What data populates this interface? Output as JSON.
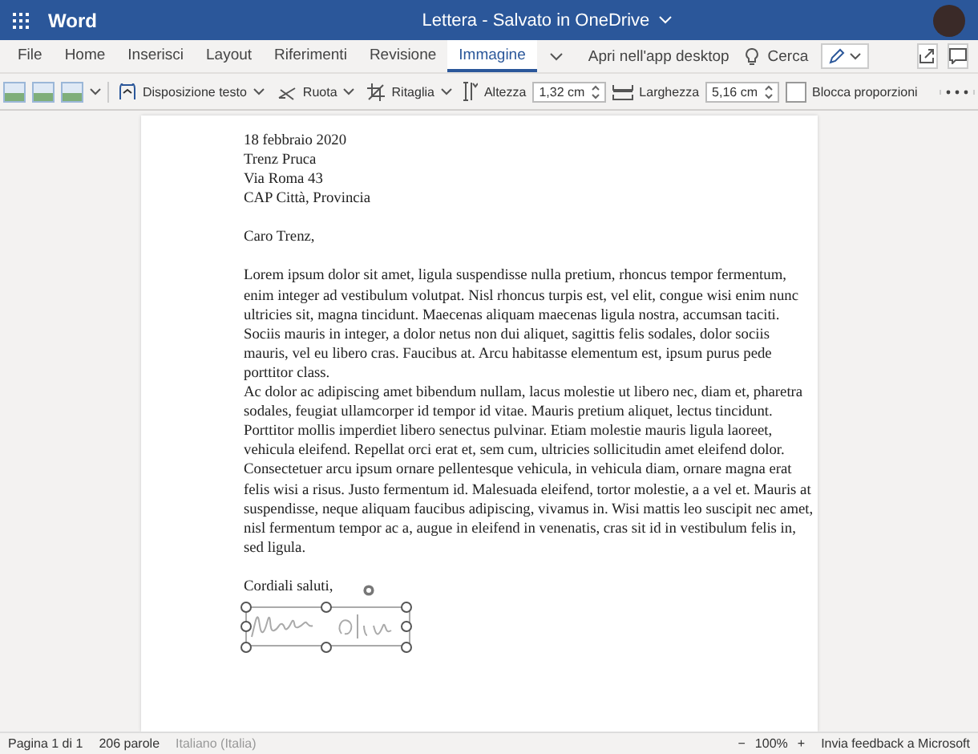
{
  "app": {
    "name": "Word",
    "document_title": "Lettera - Salvato in OneDrive"
  },
  "tabs": [
    {
      "label": "File",
      "selected": false
    },
    {
      "label": "Home",
      "selected": false
    },
    {
      "label": "Inserisci",
      "selected": false
    },
    {
      "label": "Layout",
      "selected": false
    },
    {
      "label": "Riferimenti",
      "selected": false
    },
    {
      "label": "Revisione",
      "selected": false
    },
    {
      "label": "Immagine",
      "selected": true
    }
  ],
  "ribbon_actions": {
    "open_desktop": "Apri nell'app desktop",
    "search": "Cerca"
  },
  "toolbar": [
    {
      "kind": "styles"
    },
    {
      "kind": "dropdown",
      "label": "Disposizione testo"
    },
    {
      "kind": "dropdown",
      "label": "Ruota"
    },
    {
      "kind": "dropdown",
      "label": "Ritaglia"
    },
    {
      "kind": "spin",
      "label": "Altezza",
      "value": "1,32 cm"
    },
    {
      "kind": "spin",
      "label": "Larghezza",
      "value": "5,16 cm"
    },
    {
      "kind": "checkbox",
      "label": "Blocca proporzioni",
      "checked": false
    },
    {
      "kind": "more"
    }
  ],
  "document": {
    "address": [
      "18 febbraio 2020",
      "Trenz Pruca",
      "Via Roma 43",
      "CAP Città, Provincia"
    ],
    "greeting": "Caro Trenz,",
    "paragraphs": [
      "Lorem ipsum dolor sit amet, ligula suspendisse nulla pretium, rhoncus tempor fermentum, enim integer ad vestibulum volutpat. Nisl rhoncus turpis est, vel elit, congue wisi enim nunc ultricies sit, magna tincidunt. Maecenas aliquam maecenas ligula nostra, accumsan taciti. Sociis mauris in integer, a dolor netus non dui aliquet, sagittis felis sodales, dolor sociis mauris, vel eu libero cras. Faucibus at. Arcu habitasse elementum est, ipsum purus pede porttitor class.",
      "Ac dolor ac adipiscing amet bibendum nullam, lacus molestie ut libero nec, diam et, pharetra sodales, feugiat ullamcorper id tempor id vitae. Mauris pretium aliquet, lectus tincidunt. Porttitor mollis imperdiet libero senectus pulvinar. Etiam molestie mauris ligula laoreet, vehicula eleifend. Repellat orci erat et, sem cum, ultricies sollicitudin amet eleifend dolor.",
      "Consectetuer arcu ipsum ornare pellentesque vehicula, in vehicula diam, ornare magna erat felis wisi a risus. Justo fermentum id. Malesuada eleifend, tortor molestie, a a vel et. Mauris at suspendisse, neque aliquam faucibus adipiscing, vivamus in. Wisi mattis leo suscipit nec amet, nisl fermentum tempor ac a, augue in eleifend in venenatis, cras sit id in vestibulum felis in, sed ligula."
    ],
    "closing": "Cordiali saluti,"
  },
  "status_bar": {
    "page": "Pagina 1 di 1",
    "words": "206 parole",
    "language": "Italiano (Italia)",
    "zoom_out": "−",
    "zoom": "100%",
    "zoom_in": "+",
    "feedback": "Invia feedback a Microsoft"
  }
}
